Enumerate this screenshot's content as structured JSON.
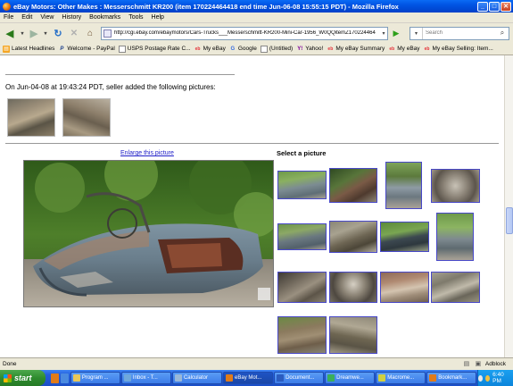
{
  "window": {
    "title": "eBay Motors: Other Makes : Messerschmitt KR200 (item 170224464418 end time Jun-06-08 15:55:15 PDT) - Mozilla Firefox",
    "minimize": "_",
    "maximize": "□",
    "close": "✕"
  },
  "menu": [
    "File",
    "Edit",
    "View",
    "History",
    "Bookmarks",
    "Tools",
    "Help"
  ],
  "toolbar": {
    "url": "http://cgi.ebay.com/ebaymotors/Cars-Trucks___Messerschmitt-KR200-Mini-Car-1956_W0QQitemZ170224464",
    "search_placeholder": "Search",
    "back_icon": "◀",
    "forward_icon": "▶",
    "dropdown_icon": "▾",
    "reload_icon": "↻",
    "stop_icon": "✕",
    "home_icon": "⌂",
    "go_icon": "▶",
    "search_icon": "⌕"
  },
  "bookmarks": [
    {
      "label": "Latest Headlines",
      "icon": "feed-icon",
      "glyph": "▤"
    },
    {
      "label": "Welcome - PayPal",
      "icon": "paypal-icon",
      "glyph": "P"
    },
    {
      "label": "USPS Postage Rate C...",
      "icon": "page-icon",
      "glyph": ""
    },
    {
      "label": "My eBay",
      "icon": "ebay-icon",
      "glyph": "eb"
    },
    {
      "label": "Google",
      "icon": "google-icon",
      "glyph": "G"
    },
    {
      "label": "(Untitled)",
      "icon": "page-icon",
      "glyph": ""
    },
    {
      "label": "Yahoo!",
      "icon": "yahoo-icon",
      "glyph": "Y!"
    },
    {
      "label": "My eBay Summary",
      "icon": "ebay-icon",
      "glyph": "eb"
    },
    {
      "label": "My eBay",
      "icon": "ebay-icon",
      "glyph": "eb"
    },
    {
      "label": "My eBay Selling: Item...",
      "icon": "ebay-icon",
      "glyph": "eb"
    }
  ],
  "content": {
    "seller_line": "On Jun-04-08 at 19:43:24 PDT, seller added the following pictures:",
    "enlarge_link": "Enlarge this picture",
    "select_heading": "Select a picture"
  },
  "status": {
    "text": "Done",
    "adblock": "Adblock"
  },
  "taskbar": {
    "start_label": "start",
    "tasks": [
      {
        "label": "Program ...",
        "color": "#E8C85A"
      },
      {
        "label": "Inbox - T...",
        "color": "#6FA8DC"
      },
      {
        "label": "Calculator",
        "color": "#9AB8D8"
      },
      {
        "label": "eBay Mot...",
        "color": "#E07B1A"
      },
      {
        "label": "Document...",
        "color": "#2B5CC0"
      },
      {
        "label": "Dreamwe...",
        "color": "#3BAF5A"
      },
      {
        "label": "Macrome...",
        "color": "#D0D040"
      },
      {
        "label": "Bookmark...",
        "color": "#E07B1A"
      }
    ],
    "clock": "6:40 PM"
  }
}
